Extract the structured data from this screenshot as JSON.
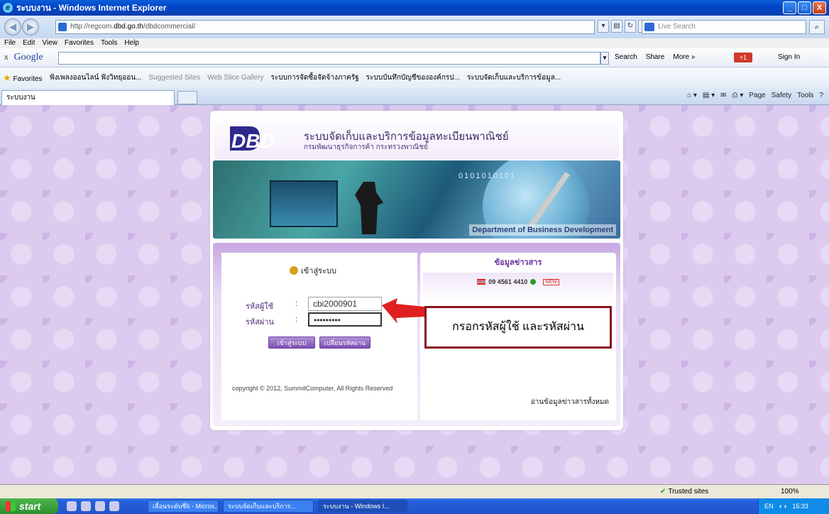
{
  "window": {
    "title": "ระบบงาน - Windows Internet Explorer",
    "minimize": "_",
    "maximize": "□",
    "close": "X"
  },
  "address": {
    "url_prefix": "http://regcom.",
    "url_domain": "dbd.go.th",
    "url_suffix": "/dbdcommercial/",
    "search_placeholder": "Live Search"
  },
  "menu": [
    "File",
    "Edit",
    "View",
    "Favorites",
    "Tools",
    "Help"
  ],
  "google_bar": {
    "close": "x",
    "logo": "Google",
    "search": "Search",
    "share": "Share",
    "more": "More »",
    "plus": "+1",
    "signin": "Sign In"
  },
  "favorites": {
    "label": "Favorites",
    "items": [
      "ฟังเพลงออนไลน์ ฟังวิทยุออน...",
      "Suggested Sites",
      "Web Slice Gallery",
      "ระบบการจัดซื้อจัดจ้างภาครัฐ",
      "ระบบบันทึกบัญชีขององค์กรป...",
      "ระบบจัดเก็บและบริการข้อมูล..."
    ]
  },
  "tab": {
    "label": "ระบบงาน"
  },
  "commands": [
    "Page",
    "Safety",
    "Tools"
  ],
  "page": {
    "title": "ระบบจัดเก็บและบริการข้อมูลทะเบียนพาณิชย์",
    "subtitle": "กรมพัฒนาธุรกิจการค้า กระทรวงพาณิชย์",
    "logo": "DBD",
    "banner_caption": "Department of Business Development",
    "banner_digits": "0101010101",
    "login": {
      "title": "เข้าสู่ระบบ",
      "username_label": "รหัสผู้ใช้",
      "password_label": "รหัสผ่าน",
      "colon": ":",
      "username_value": "cbi2000901",
      "password_value": "•••••••••",
      "login_button": "เข้าสู่ระบบ",
      "change_password_button": "เปลี่ยนรหัสผ่าน"
    },
    "copyright": "copyright © 2012, SummitComputer, All Rights Reserved",
    "news": {
      "title": "ข้อมูลข่าวสาร",
      "item": "09 4561 4410",
      "new_badge": "NEW",
      "read_all": "อ่านข้อมูลข่าวสารทั้งหมด"
    },
    "annotation": "กรอกรหัสผู้ใช้  และรหัสผ่าน"
  },
  "status": {
    "trusted": "Trusted sites",
    "zoom": "100%"
  },
  "taskbar": {
    "start": "start",
    "tasks": [
      "เลื่อนระดับซี่6 - Micros...",
      "ระบบจัดเก็บและบริการ...",
      "ระบบงาน - Windows I..."
    ],
    "lang": "EN",
    "time": "15:33"
  },
  "colors": {
    "accent": "#7a50b2",
    "annotation_border": "#8b1020",
    "arrow": "#e02020"
  }
}
